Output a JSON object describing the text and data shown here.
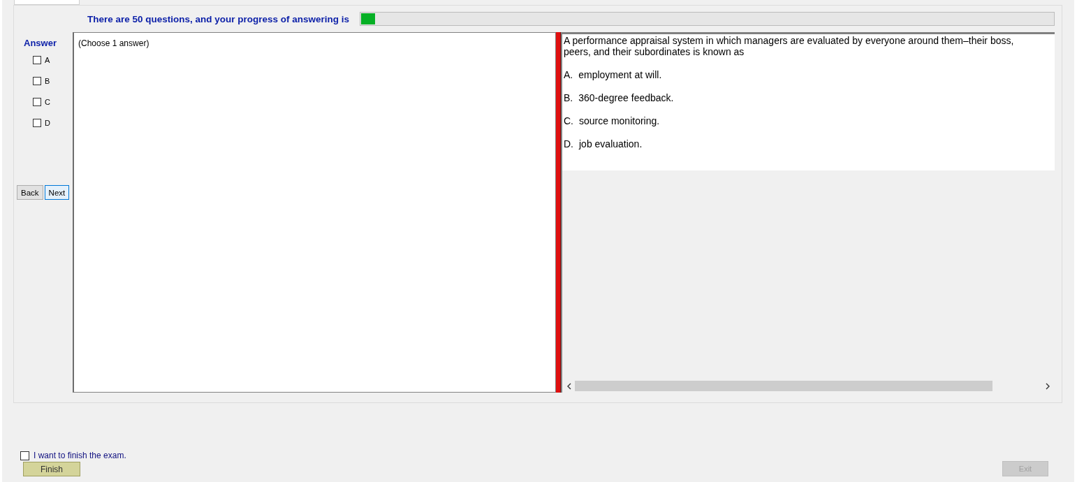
{
  "header": {
    "text": "There are 50 questions, and your progress of answering is",
    "progress": {
      "level": 0.02
    }
  },
  "answer_panel": {
    "title": "Answer",
    "options": [
      {
        "label": "A",
        "checked": false
      },
      {
        "label": "B",
        "checked": false
      },
      {
        "label": "C",
        "checked": false
      },
      {
        "label": "D",
        "checked": false
      }
    ],
    "buttons": [
      {
        "label": "Back",
        "selected": false
      },
      {
        "label": "Next",
        "selected": true
      }
    ]
  },
  "answer_area": {
    "hint": "(Choose 1 answer)"
  },
  "question": {
    "lines": [
      "A performance appraisal system in which managers are evaluated by everyone around them–their boss,",
      "peers, and their subordinates is known as"
    ],
    "choices": [
      {
        "letter": "A.",
        "text": "employment at will."
      },
      {
        "letter": "B.",
        "text": "360-degree feedback."
      },
      {
        "letter": "C.",
        "text": "source monitoring."
      },
      {
        "letter": "D.",
        "text": "job evaluation."
      }
    ]
  },
  "finish": {
    "label": "I want to finish the exam.",
    "checked": false,
    "button": {
      "label": "Finish",
      "disabled": false
    }
  },
  "exit_button": {
    "label": "Exit",
    "disabled": true
  }
}
